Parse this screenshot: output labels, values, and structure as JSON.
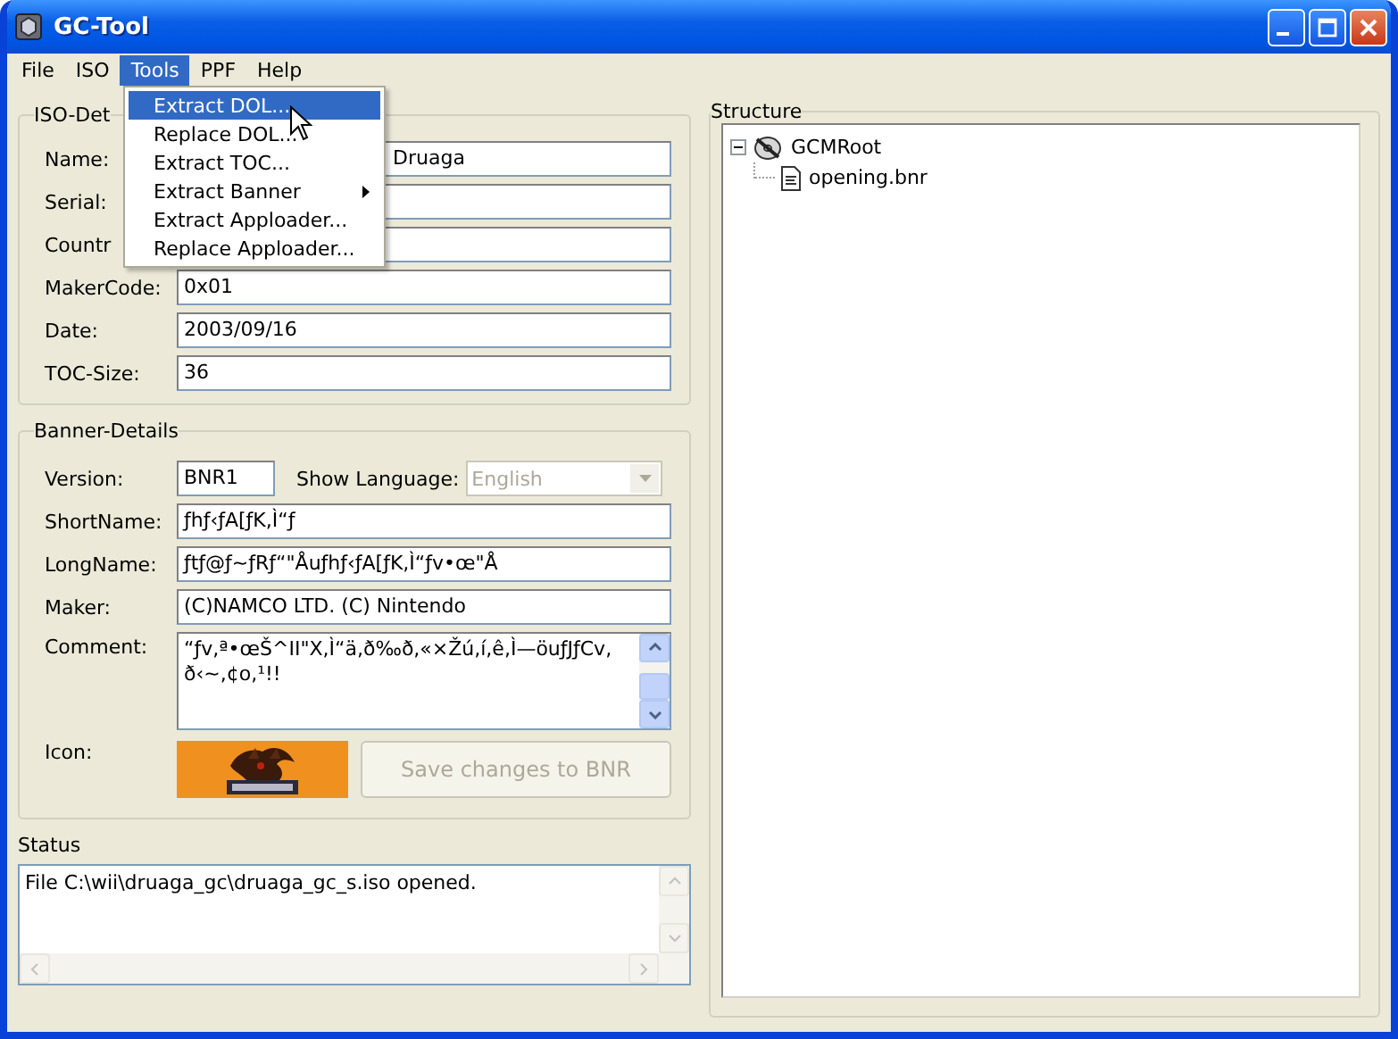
{
  "window": {
    "title": "GC-Tool"
  },
  "menu": [
    {
      "label": "File",
      "selected": false
    },
    {
      "label": "ISO",
      "selected": false
    },
    {
      "label": "Tools",
      "selected": true
    },
    {
      "label": "PPF",
      "selected": false
    },
    {
      "label": "Help",
      "selected": false
    }
  ],
  "tools_menu": {
    "items": [
      {
        "label": "Extract DOL...",
        "selected": true,
        "submenu": false
      },
      {
        "label": "Replace DOL...",
        "selected": false,
        "submenu": false
      },
      {
        "label": "Extract TOC...",
        "selected": false,
        "submenu": false
      },
      {
        "label": "Extract Banner",
        "selected": false,
        "submenu": true
      },
      {
        "label": "Extract Apploader...",
        "selected": false,
        "submenu": false
      },
      {
        "label": "Replace Apploader...",
        "selected": false,
        "submenu": false
      }
    ]
  },
  "iso_details": {
    "title": "ISO-Det",
    "fields": [
      {
        "label": "Name:",
        "value": "Druaga",
        "kind": "covered"
      },
      {
        "label": "Serial:",
        "kind": "plain"
      },
      {
        "label": "Countr",
        "kind": "plain"
      },
      {
        "label": "MakerCode:",
        "value": "0x01",
        "kind": "plain"
      },
      {
        "label": "Date:",
        "value": "2003/09/16",
        "kind": "plain"
      },
      {
        "label": "TOC-Size:",
        "value": "36",
        "kind": "plain"
      }
    ]
  },
  "banner_details": {
    "title": "Banner-Details",
    "version": {
      "label": "Version:",
      "value": "BNR1"
    },
    "show_language": {
      "label": "Show Language:",
      "value": "English",
      "disabled": true
    },
    "fields": [
      {
        "label": "ShortName:",
        "value": "ƒhƒ‹ƒA[ƒK,Ì“ƒ"
      },
      {
        "label": "LongName:",
        "value": "ƒtƒ@ƒ~ƒRƒ“\"Åuƒhƒ‹ƒA[ƒK,Ì“ƒv•œ\"Å"
      },
      {
        "label": "Maker:",
        "value": "(C)NAMCO LTD. (C) Nintendo"
      }
    ],
    "comment": {
      "label": "Comment:",
      "value": "“ƒv,ª•œŠ^II\"X,Ì“ä,ð‰ð,«×Žú,í,ê,Ì—öuƒJƒCv,ð‹~,¢o,¹!!"
    },
    "icon": {
      "label": "Icon:",
      "kind": "picture"
    },
    "save_button": {
      "label": "Save changes to BNR",
      "disabled": true
    }
  },
  "status": {
    "title": "Status",
    "text": "File C:\\wii\\druaga_gc\\druaga_gc_s.iso opened."
  },
  "structure": {
    "title": "Structure",
    "tree": [
      {
        "label": "GCMRoot",
        "expanded": true,
        "children": [
          {
            "label": "opening.bnr"
          }
        ]
      }
    ]
  }
}
